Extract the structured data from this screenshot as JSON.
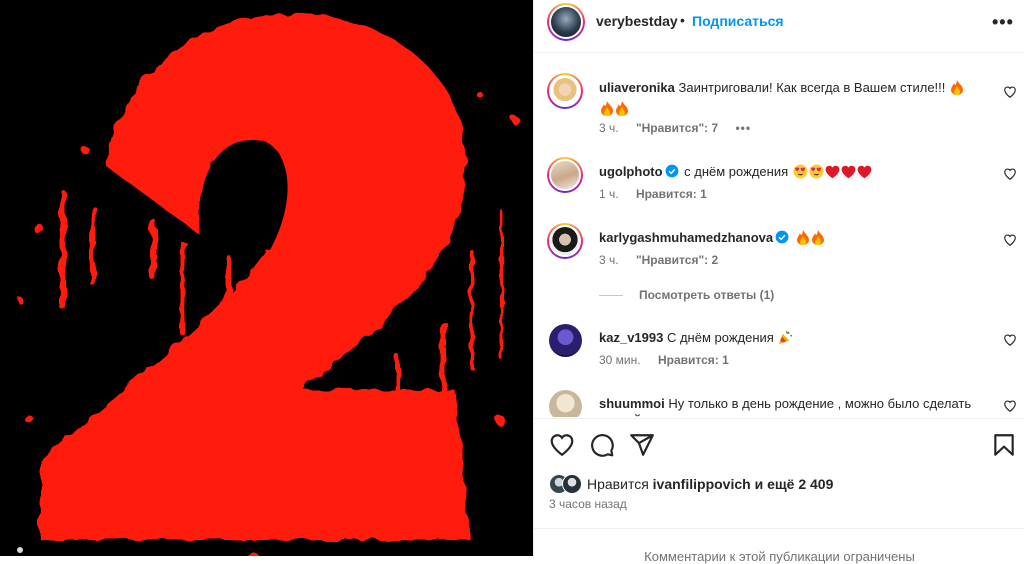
{
  "header": {
    "username": "verybestday",
    "separator": "•",
    "follow_label": "Подписаться",
    "more_label": "•••"
  },
  "comments": [
    {
      "username": "uliaveronika",
      "text": "Заинтриговали! Как всегда в Вашем стиле!!!",
      "emoji": [
        "fire",
        "fire",
        "fire"
      ],
      "time": "3 ч.",
      "likes": "\"Нравится\": 7",
      "has_more": true,
      "verified": false
    },
    {
      "username": "ugolphoto",
      "text": "с днём рождения",
      "emoji": [
        "heart-eyes",
        "heart-eyes",
        "red-heart",
        "red-heart",
        "red-heart"
      ],
      "time": "1 ч.",
      "likes": "Нравится: 1",
      "verified": true
    },
    {
      "username": "karlygashmuhamedzhanova",
      "text": "",
      "emoji": [
        "fire",
        "fire"
      ],
      "time": "3 ч.",
      "likes": "\"Нравится\": 2",
      "verified": true
    },
    {
      "username": "kaz_v1993",
      "text": "С днём рождения",
      "emoji": [
        "party-popper"
      ],
      "time": "30 мин.",
      "likes": "Нравится: 1",
      "verified": false
    },
    {
      "username": "shuummoi",
      "text": "Ну только в день рождение , можно было сделать ТАКОЙ подарок для всех! Когда всем и все понятно",
      "time": "",
      "likes": "",
      "verified": false
    }
  ],
  "view_replies": "Посмотреть ответы (1)",
  "likes_summary": {
    "prefix": "Нравится",
    "user": "ivanfilippovich",
    "suffix": "и ещё 2 409"
  },
  "time_ago": "3 часов назад",
  "footer_text": "Комментарии к этой публикации ограничены",
  "colors": {
    "accent": "#0095f6",
    "media_red": "#ff1a0a",
    "text": "#262626",
    "muted": "#737373"
  },
  "icons": [
    "heart-icon",
    "comment-icon",
    "share-icon",
    "bookmark-icon",
    "more-icon",
    "verified-icon"
  ]
}
